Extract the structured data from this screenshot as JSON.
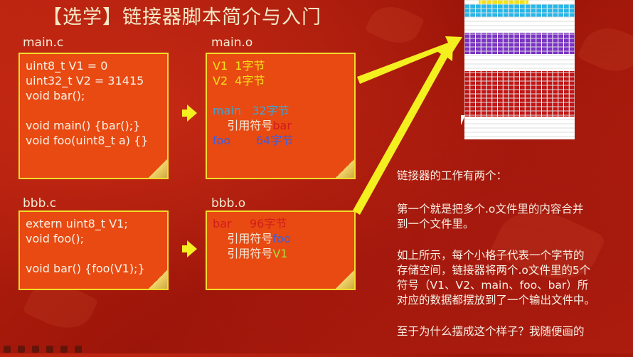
{
  "title": "【选学】链接器脚本简介与入门",
  "files": {
    "main_c": {
      "label": "main.c",
      "lines": [
        "uint8_t V1 = 0",
        "uint32_t V2 = 31415",
        "void bar();",
        "",
        "void main() {bar();}",
        "void foo(uint8_t a) {}"
      ]
    },
    "main_o": {
      "label": "main.o",
      "v1_name": "V1",
      "v1_size": "1字节",
      "v2_name": "V2",
      "v2_size": "4字节",
      "main_name": "main",
      "main_size": "32字节",
      "ref_label": "引用符号",
      "ref_bar": "bar",
      "foo_name": "foo",
      "foo_size": "64字节"
    },
    "bbb_c": {
      "label": "bbb.c",
      "lines": [
        "extern uint8_t V1;",
        "void foo();",
        "",
        "void bar() {foo(V1);}"
      ]
    },
    "bbb_o": {
      "label": "bbb.o",
      "bar_name": "bar",
      "bar_size": "96字节",
      "ref_label1": "引用符号",
      "ref_foo": "foo",
      "ref_label2": "引用符号",
      "ref_v1": "V1"
    }
  },
  "explanation": {
    "heading": "链接器的工作有两个：",
    "p1": [
      "第一个就是把多个.o文件里的内容合并",
      "到一个文件里。"
    ],
    "p2": [
      "如上所示，每个小格子代表一个字节的",
      "存储空间，链接器将两个.o文件里的5个",
      "符号（V1、V2、main、foo、bar）所",
      "对应的数据都摆放到了一个输出文件中。"
    ],
    "p3": [
      "至于为什么摆成这个样子？我随便画的"
    ]
  },
  "memory_colors": {
    "v1": "#f2e21a",
    "v2": "#29b6e8",
    "main": "#7b34c4",
    "foo": "#c01616",
    "grid": "#ffffff"
  },
  "icons": [
    "arrow-right-icon",
    "arrow-right-icon"
  ]
}
